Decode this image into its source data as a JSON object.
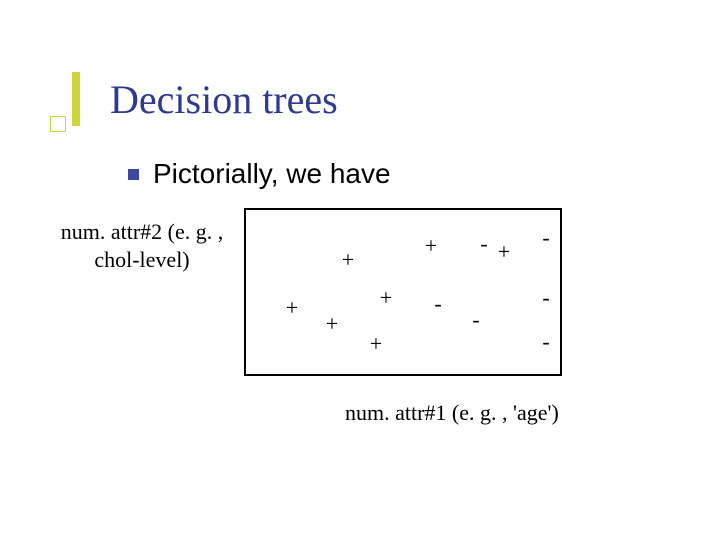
{
  "title": "Decision trees",
  "bullet": "Pictorially, we have",
  "y_axis_label": "num. attr#2 (e. g. , chol-level)",
  "x_axis_label": "num. attr#1 (e. g. , 'age')",
  "chart_data": {
    "type": "scatter",
    "title": "",
    "xlabel": "num. attr#1 (e. g. , 'age')",
    "ylabel": "num. attr#2 (e. g. , chol-level)",
    "xlim": [
      0,
      318
    ],
    "ylim": [
      0,
      168
    ],
    "series": [
      {
        "name": "plus",
        "symbol": "+",
        "points": [
          {
            "x": 102,
            "y": 118
          },
          {
            "x": 185,
            "y": 132
          },
          {
            "x": 258,
            "y": 126
          },
          {
            "x": 46,
            "y": 70
          },
          {
            "x": 86,
            "y": 54
          },
          {
            "x": 140,
            "y": 80
          },
          {
            "x": 130,
            "y": 34
          }
        ]
      },
      {
        "name": "minus",
        "symbol": "-",
        "points": [
          {
            "x": 238,
            "y": 134
          },
          {
            "x": 300,
            "y": 140
          },
          {
            "x": 192,
            "y": 74
          },
          {
            "x": 230,
            "y": 58
          },
          {
            "x": 300,
            "y": 80
          },
          {
            "x": 300,
            "y": 36
          }
        ]
      }
    ]
  }
}
